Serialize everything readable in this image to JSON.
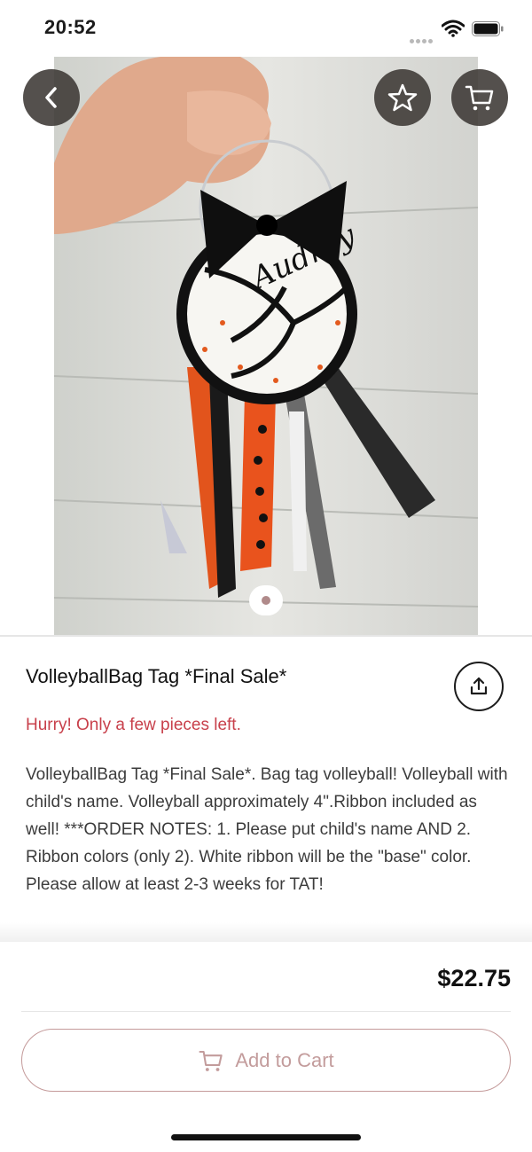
{
  "status_bar": {
    "time": "20:52"
  },
  "product": {
    "title": "VolleyballBag Tag *Final Sale*",
    "stock_note": "Hurry! Only a few pieces left.",
    "description": "VolleyballBag Tag *Final Sale*. Bag tag volleyball! Volleyball with child's name. Volleyball approximately 4\".Ribbon included as well! ***ORDER NOTES: 1. Please put child's name AND 2. Ribbon colors (only 2). White ribbon will be the \"base\" color. Please allow at least 2-3 weeks for TAT!",
    "price": "$22.75",
    "image_name_text": "Audrey",
    "image_count": 1,
    "current_image": 1
  },
  "actions": {
    "add_to_cart_label": "Add to Cart"
  },
  "colors": {
    "accent_button_border": "#c49a9a",
    "stock_note": "#c8404b",
    "overlay_button": "#3c3834"
  },
  "icons": [
    "back-chevron-icon",
    "star-icon",
    "cart-icon",
    "share-icon",
    "wifi-icon",
    "battery-icon"
  ]
}
